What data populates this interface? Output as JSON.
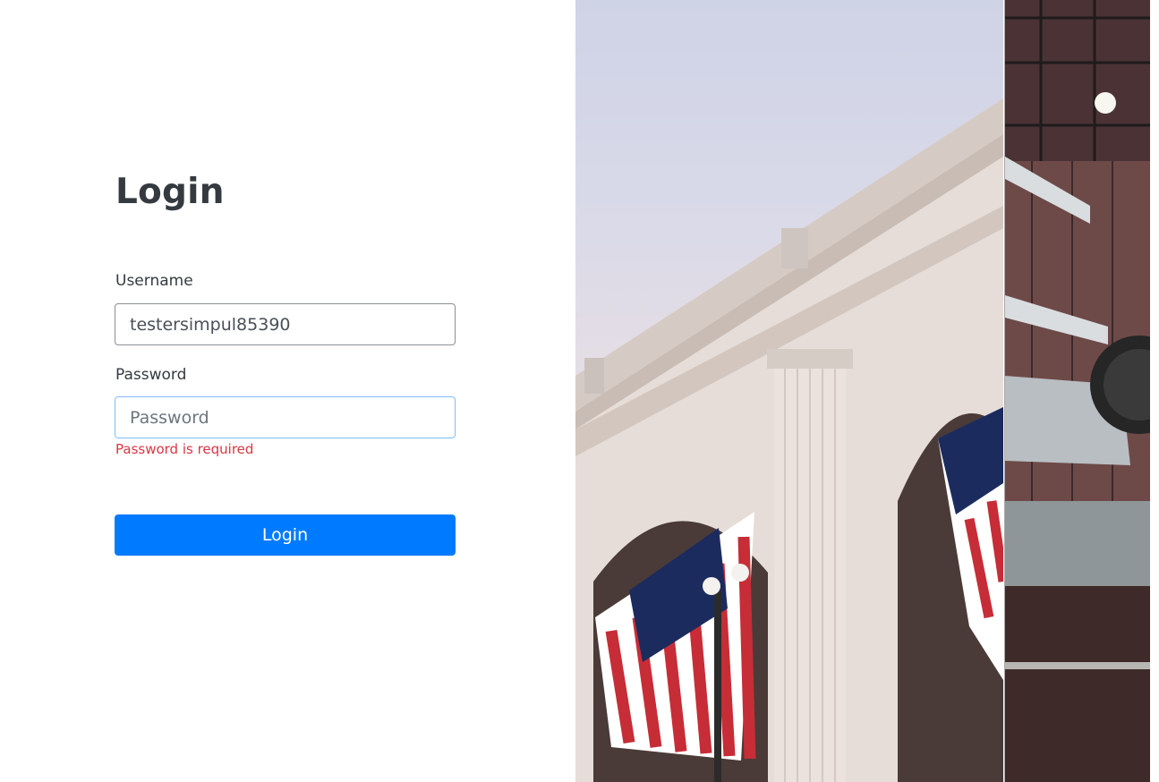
{
  "form": {
    "title": "Login",
    "username_label": "Username",
    "username_value": "testersimpul85390",
    "password_label": "Password",
    "password_placeholder": "Password",
    "password_error": "Password is required",
    "submit_label": "Login"
  },
  "colors": {
    "primary": "#007bff",
    "error": "#dc3545",
    "heading": "#343a40"
  },
  "images": {
    "hero_icon": "union-station-flags-image",
    "side_icon": "aircraft-hangar-image"
  }
}
